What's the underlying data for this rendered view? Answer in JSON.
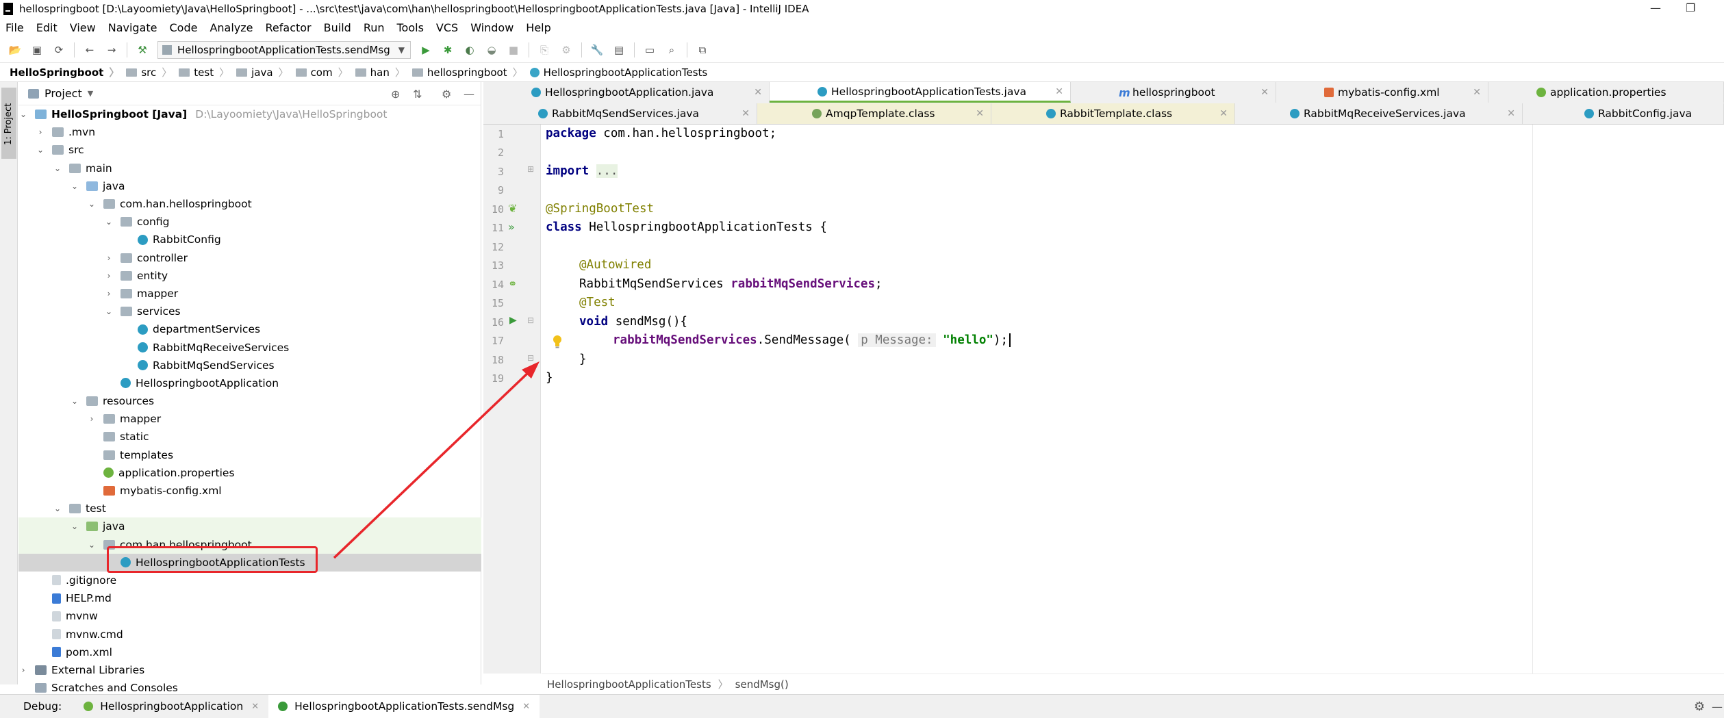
{
  "window": {
    "title": "hellospringboot [D:\\Layoomiety\\Java\\HelloSpringboot] - ...\\src\\test\\java\\com\\han\\hellospringboot\\HellospringbootApplicationTests.java [Java] - IntelliJ IDEA",
    "minimize": "—",
    "restore": "❐"
  },
  "menu": [
    "File",
    "Edit",
    "View",
    "Navigate",
    "Code",
    "Analyze",
    "Refactor",
    "Build",
    "Run",
    "Tools",
    "VCS",
    "Window",
    "Help"
  ],
  "toolbar": {
    "run_config": "HellospringbootApplicationTests.sendMsg"
  },
  "navbar": {
    "crumbs": [
      "HelloSpringboot",
      "src",
      "test",
      "java",
      "com",
      "han",
      "hellospringboot"
    ],
    "current": "HellospringbootApplicationTests"
  },
  "left_strip": {
    "project_tab": "1: Project"
  },
  "project_panel": {
    "title": "Project",
    "tree": [
      {
        "label": "HelloSpringboot [Java]",
        "hint": "D:\\Layoomiety\\Java\\HelloSpringboot"
      },
      {
        "label": ".mvn"
      },
      {
        "label": "src"
      },
      {
        "label": "main"
      },
      {
        "label": "java"
      },
      {
        "label": "com.han.hellospringboot"
      },
      {
        "label": "config"
      },
      {
        "label": "RabbitConfig"
      },
      {
        "label": "controller"
      },
      {
        "label": "entity"
      },
      {
        "label": "mapper"
      },
      {
        "label": "services"
      },
      {
        "label": "departmentServices"
      },
      {
        "label": "RabbitMqReceiveServices"
      },
      {
        "label": "RabbitMqSendServices"
      },
      {
        "label": "HellospringbootApplication"
      },
      {
        "label": "resources"
      },
      {
        "label": "mapper"
      },
      {
        "label": "static"
      },
      {
        "label": "templates"
      },
      {
        "label": "application.properties"
      },
      {
        "label": "mybatis-config.xml"
      },
      {
        "label": "test"
      },
      {
        "label": "java"
      },
      {
        "label": "com.han.hellospringboot"
      },
      {
        "label": "HellospringbootApplicationTests"
      },
      {
        "label": ".gitignore"
      },
      {
        "label": "HELP.md"
      },
      {
        "label": "mvnw"
      },
      {
        "label": "mvnw.cmd"
      },
      {
        "label": "pom.xml"
      },
      {
        "label": "External Libraries"
      },
      {
        "label": "Scratches and Consoles"
      }
    ]
  },
  "editor_tabs": {
    "row1": [
      "HellospringbootApplication.java",
      "HellospringbootApplicationTests.java",
      "hellospringboot",
      "mybatis-config.xml",
      "application.properties"
    ],
    "row2": [
      "RabbitMqSendServices.java",
      "AmqpTemplate.class",
      "RabbitTemplate.class",
      "RabbitMqReceiveServices.java",
      "RabbitConfig.java"
    ]
  },
  "editor": {
    "line_numbers": [
      "1",
      "2",
      "3",
      "9",
      "10",
      "11",
      "12",
      "13",
      "14",
      "15",
      "16",
      "17",
      "18",
      "19"
    ],
    "code": {
      "l1_kw": "package",
      "l1_rest": " com.han.hellospringboot;",
      "l3_kw": "import",
      "l3_fold": "...",
      "l10": "@SpringBootTest",
      "l11_kw": "class",
      "l11_rest": " HellospringbootApplicationTests {",
      "l13": "@Autowired",
      "l14_type": "RabbitMqSendServices ",
      "l14_field": "rabbitMqSendServices",
      "l14_end": ";",
      "l15": "@Test",
      "l16_kw": "void",
      "l16_rest": " sendMsg(){",
      "l17_field": "rabbitMqSendServices",
      "l17_call": ".SendMessage(",
      "l17_hint": "p Message:",
      "l17_str": "\"hello\"",
      "l17_end": ");",
      "l18": "}",
      "l19": "}"
    },
    "breadcrumb": [
      "HellospringbootApplicationTests",
      "sendMsg()"
    ]
  },
  "debug": {
    "label": "Debug:",
    "tabs": [
      "HellospringbootApplication",
      "HellospringbootApplicationTests.sendMsg"
    ]
  },
  "colors": {
    "accent_green": "#6db33f",
    "annotation": "#808000",
    "keyword": "#000080",
    "field": "#660e7a",
    "string": "#008000",
    "highlight_box": "#e8262b"
  }
}
